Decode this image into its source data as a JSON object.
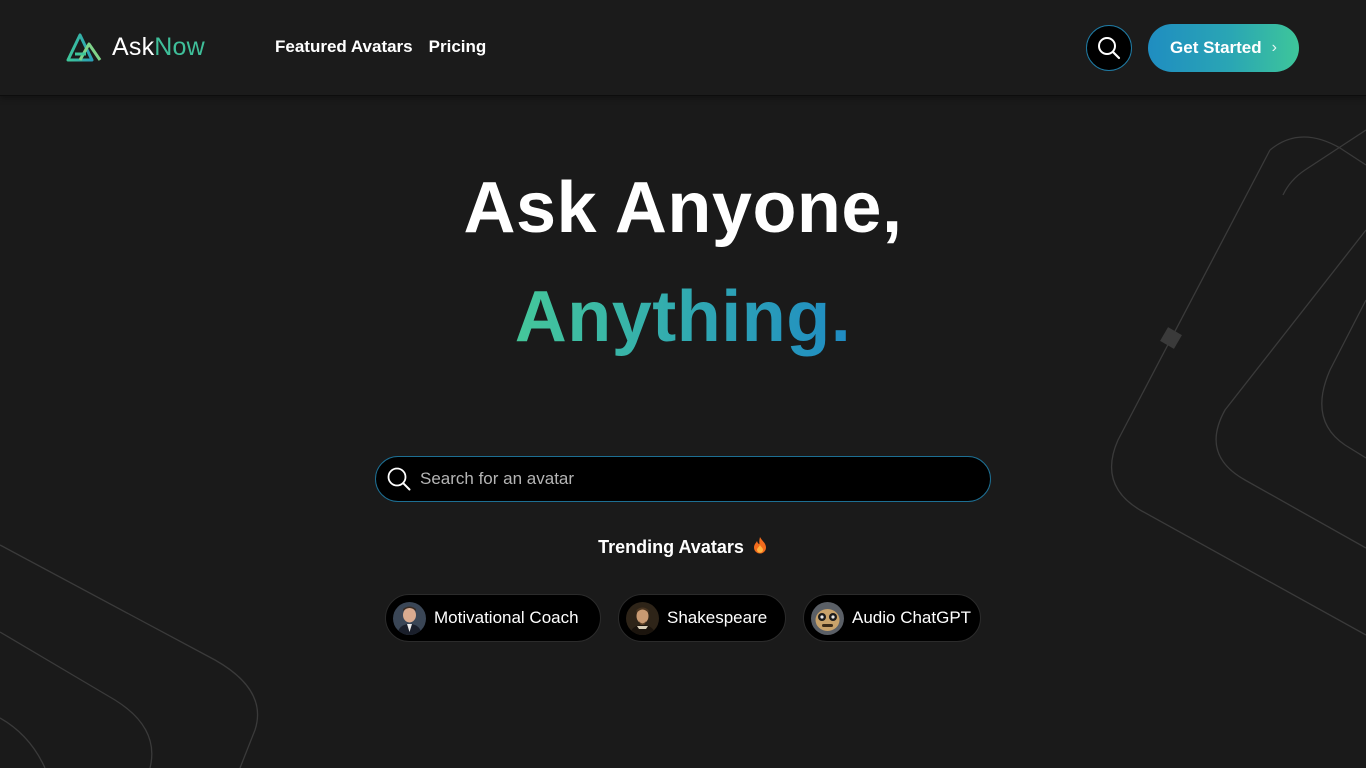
{
  "brand": {
    "name_part1": "Ask",
    "name_part2": "Now",
    "accent": "#3fbf9a",
    "logo_icon": "asknow-triangle-logo-icon"
  },
  "nav": {
    "links": [
      "Featured Avatars",
      "Pricing"
    ]
  },
  "header": {
    "search_icon": "search-icon",
    "cta_label": "Get Started",
    "cta_icon": "chevron-right-icon"
  },
  "hero": {
    "line1": "Ask Anyone,",
    "line2": "Anything."
  },
  "search": {
    "placeholder": "Search for an avatar",
    "value": ""
  },
  "trending": {
    "title": "Trending Avatars",
    "icon": "flame-icon",
    "avatars": [
      {
        "label": "Motivational Coach",
        "avatar_icon": "coach-avatar"
      },
      {
        "label": "Shakespeare",
        "avatar_icon": "shakespeare-avatar"
      },
      {
        "label": "Audio ChatGPT",
        "avatar_icon": "robot-avatar"
      }
    ]
  },
  "colors": {
    "background": "#1a1a1a",
    "gradient_start": "#1f8dc1",
    "gradient_end": "#3ec69a",
    "search_border": "#1d6f93"
  }
}
